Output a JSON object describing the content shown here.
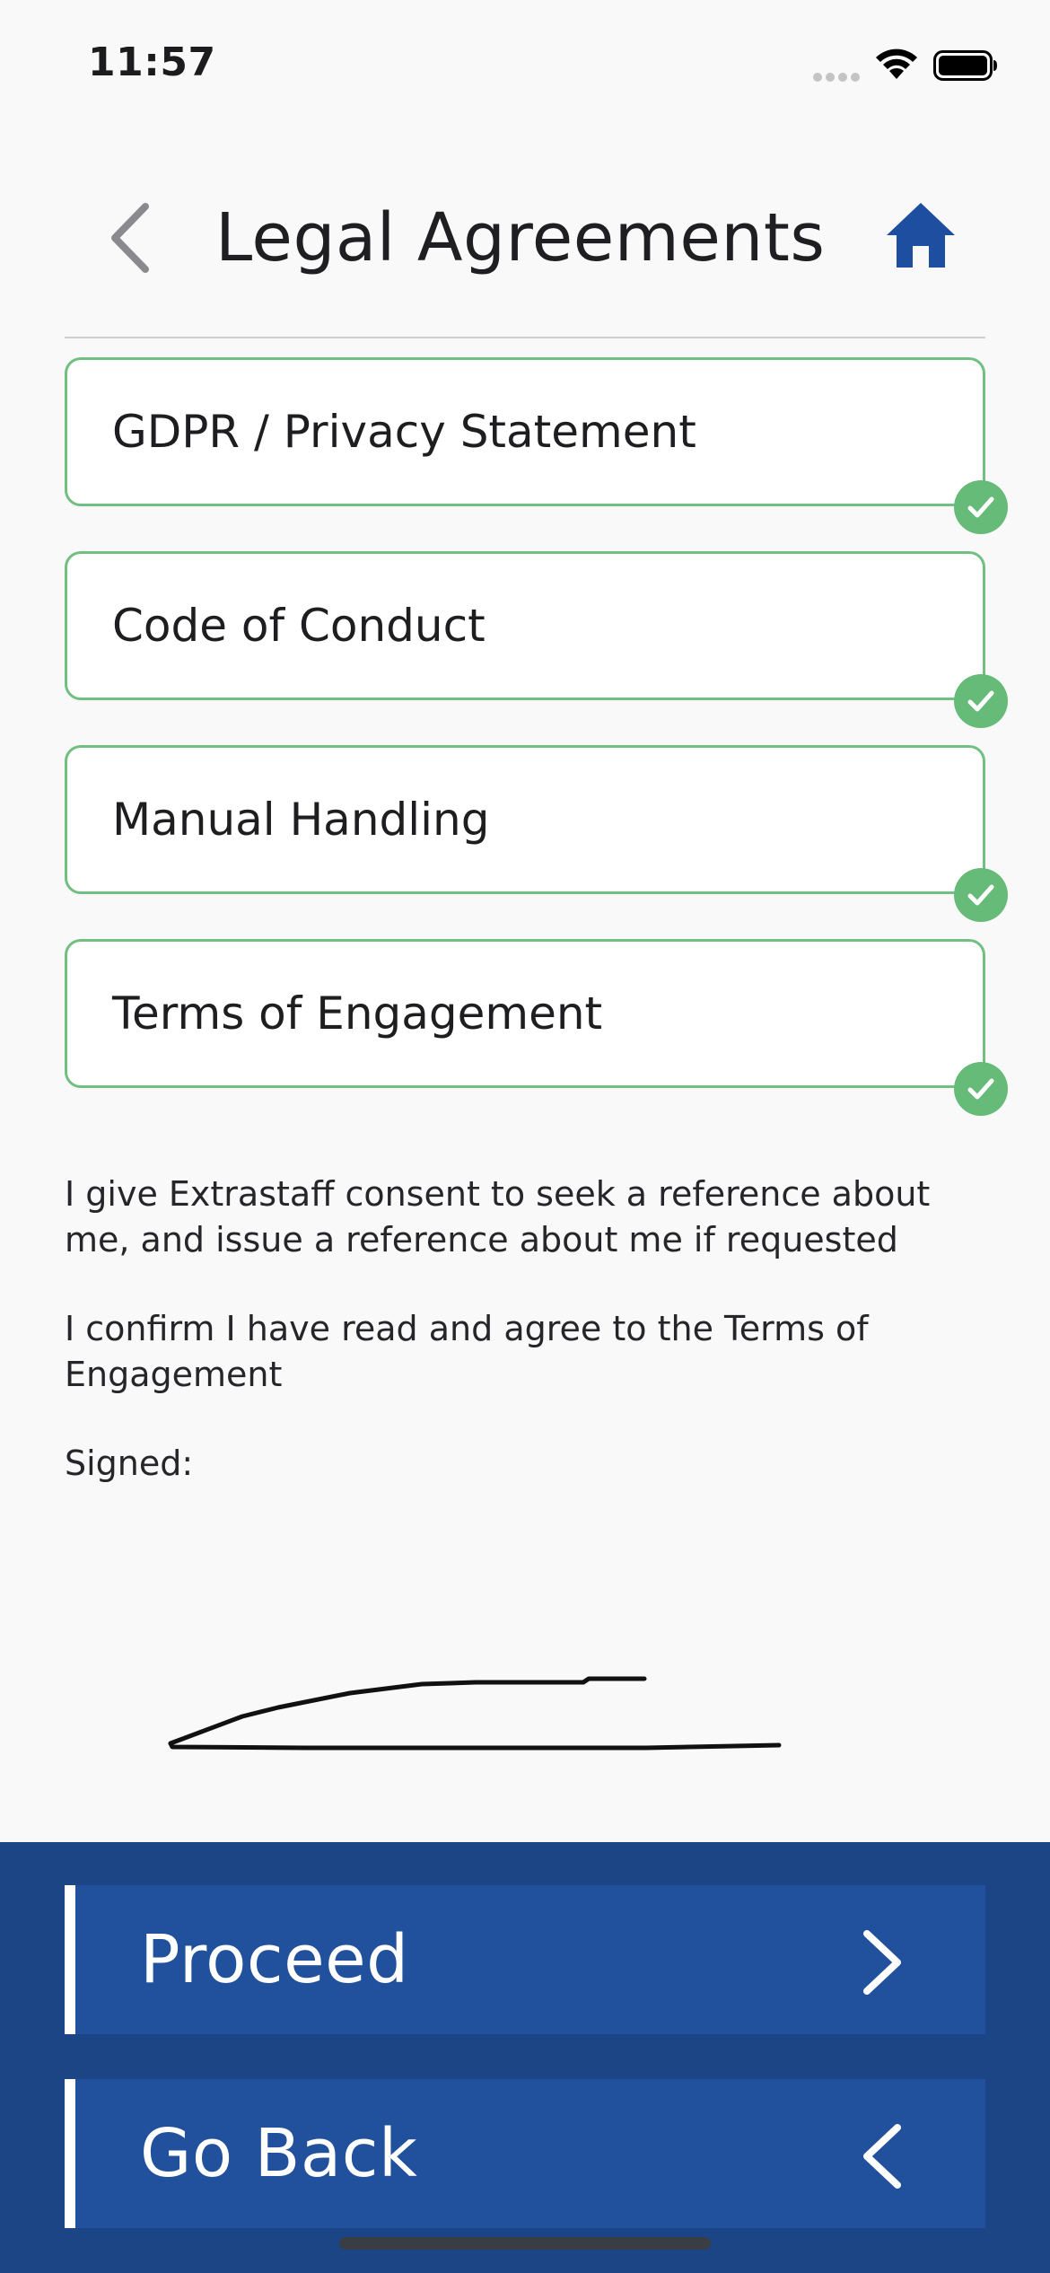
{
  "status_bar": {
    "time": "11:57",
    "signal_icon": "cellular-signal-icon",
    "wifi_icon": "wifi-icon",
    "battery_icon": "battery-icon"
  },
  "header": {
    "title": "Legal Agreements",
    "back_icon": "chevron-left-icon",
    "home_icon": "home-icon"
  },
  "agreements": [
    {
      "label": "GDPR / Privacy Statement",
      "status_icon": "check-circle-icon",
      "completed": true
    },
    {
      "label": "Code of Conduct",
      "status_icon": "check-circle-icon",
      "completed": true
    },
    {
      "label": "Manual Handling",
      "status_icon": "check-circle-icon",
      "completed": true
    },
    {
      "label": "Terms of Engagement",
      "status_icon": "check-circle-icon",
      "completed": true
    }
  ],
  "consent": {
    "reference_text": "I give Extrastaff consent to seek a reference about me, and issue a reference about me if requested",
    "terms_text": "I confirm I have read and agree to the Terms of Engagement",
    "signed_label": "Signed:"
  },
  "actions": {
    "proceed_label": "Proceed",
    "proceed_icon": "chevron-right-icon",
    "back_label": "Go Back",
    "back_icon": "chevron-left-icon"
  },
  "colors": {
    "accent_green": "#66bb78",
    "card_border": "#72c081",
    "panel_blue": "#1b4584",
    "button_blue": "#21519c",
    "home_icon_blue": "#1d4ea0"
  }
}
